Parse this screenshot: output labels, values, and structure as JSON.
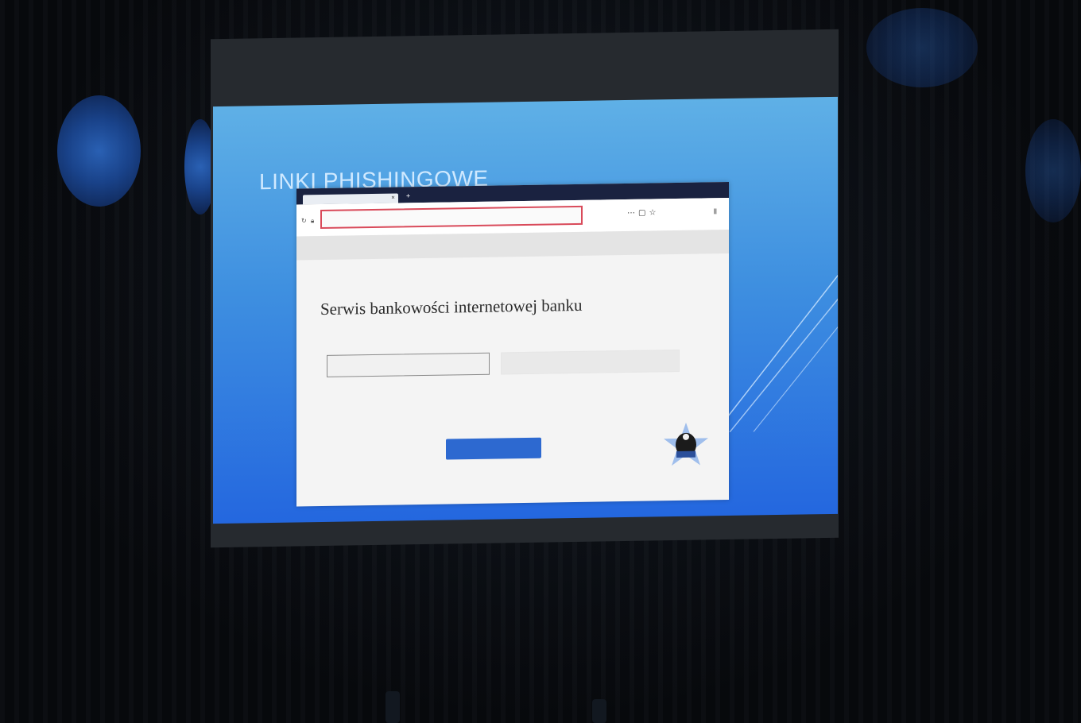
{
  "slide": {
    "title": "LINKI PHISHINGOWE"
  },
  "browser": {
    "tab_label": "",
    "url_domain": "",
    "url_text": "",
    "zoom_level": "",
    "page_heading": "Serwis bankowości internetowej banku",
    "page_subtitle": "",
    "username_placeholder": "",
    "password_placeholder": "",
    "note_text": "",
    "login_button_label": ""
  },
  "colors": {
    "slide_top": "#5fb0e6",
    "slide_bottom": "#2467df",
    "url_highlight": "#d94a5a",
    "button_blue": "#2d69d0"
  },
  "icons": {
    "police_emblem": "police-star-emblem-icon",
    "flowers": "flower-decoration-icon"
  }
}
